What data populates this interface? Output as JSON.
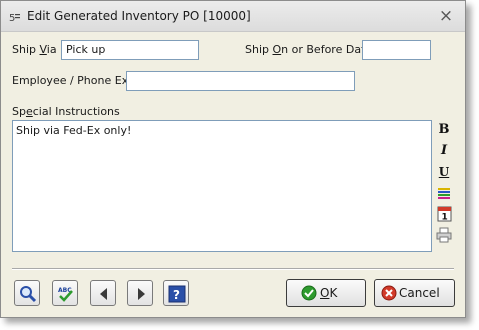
{
  "window": {
    "title": "Edit Generated Inventory PO [10000]",
    "close_symbol": "×",
    "icons": {
      "app": "app-icon",
      "close": "close-icon"
    }
  },
  "fields": {
    "ship_via": {
      "label_prefix": "Ship ",
      "label_accel": "V",
      "label_suffix": "ia",
      "value": "Pick up"
    },
    "ship_on": {
      "label_prefix": "Ship ",
      "label_accel": "O",
      "label_suffix": "n or Before Date",
      "value": ""
    },
    "employee": {
      "label": "Employee / Phone Ext.",
      "value": ""
    },
    "special": {
      "label_prefix": "Sp",
      "label_accel": "e",
      "label_suffix": "cial Instructions",
      "value": "Ship via Fed-Ex only!"
    }
  },
  "format_toolbar": {
    "bold": "B",
    "italic": "I",
    "underline": "U",
    "icons": [
      "bold-icon",
      "italic-icon",
      "underline-icon",
      "color-icon",
      "calendar-icon",
      "print-icon"
    ]
  },
  "footer": {
    "ok_accel": "O",
    "ok_rest": "K",
    "cancel_label": "Cancel",
    "icons": [
      "search-icon",
      "spellcheck-icon",
      "previous-icon",
      "next-icon",
      "help-icon",
      "ok-icon",
      "cancel-icon"
    ],
    "spell_text": "ABC"
  },
  "colors": {
    "dialog_bg": "#f1efe2",
    "input_border": "#7f9db9",
    "ok_green": "#2e9b2e",
    "cancel_red": "#d23a2a",
    "help_blue": "#2a4fa8"
  }
}
